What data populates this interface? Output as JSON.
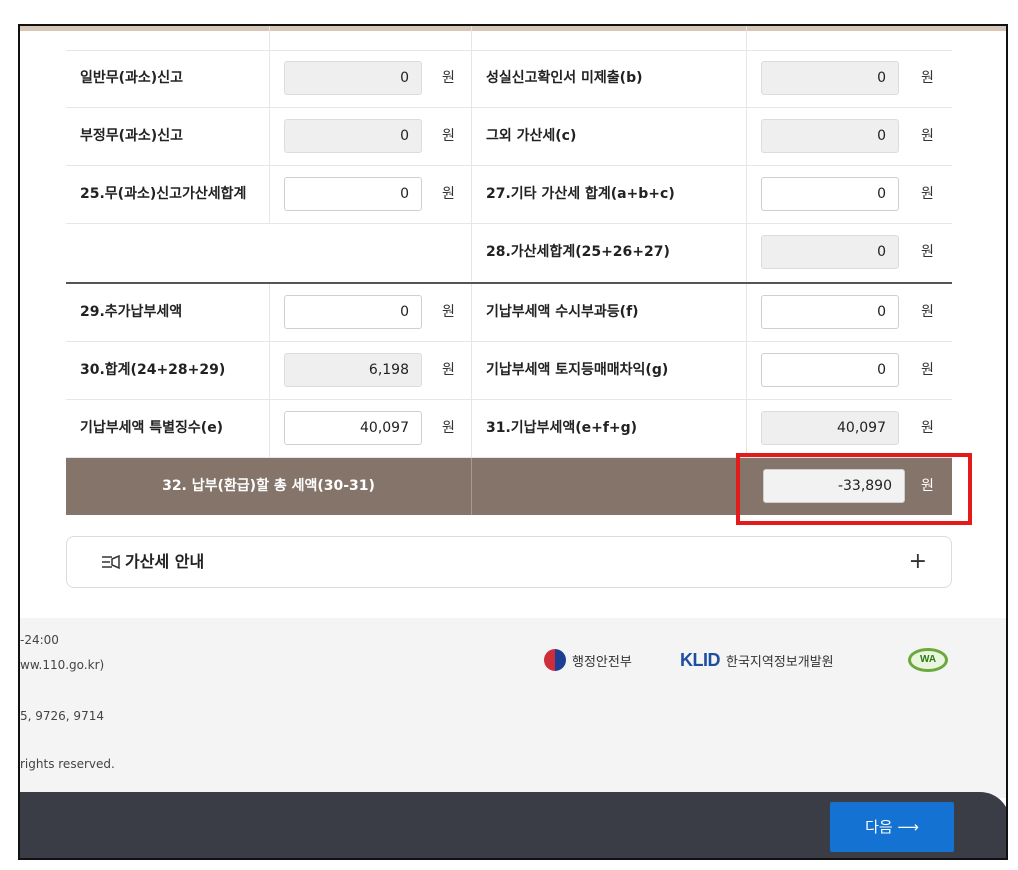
{
  "rows": [
    {
      "left_label": "일반무(과소)신고",
      "left_value": "0",
      "right_label": "성실신고확인서 미제출(b)",
      "right_value": "0"
    },
    {
      "left_label": "부정무(과소)신고",
      "left_value": "0",
      "right_label": "그외 가산세(c)",
      "right_value": "0"
    },
    {
      "left_label": "25.무(과소)신고가산세합계",
      "left_value": "0",
      "right_label": "27.기타 가산세 합계(a+b+c)",
      "right_value": "0"
    },
    {
      "left_label": "",
      "left_value": "",
      "right_label": "28.가산세합계(25+26+27)",
      "right_value": "0"
    },
    {
      "left_label": "29.추가납부세액",
      "left_value": "0",
      "right_label": "기납부세액 수시부과등(f)",
      "right_value": "0"
    },
    {
      "left_label": "30.합계(24+28+29)",
      "left_value": "6,198",
      "right_label": "기납부세액 토지등매매차익(g)",
      "right_value": "0"
    },
    {
      "left_label": "기납부세액 특별징수(e)",
      "left_value": "40,097",
      "right_label": "31.기납부세액(e+f+g)",
      "right_value": "40,097"
    }
  ],
  "unit": "원",
  "total": {
    "label": "32. 납부(환급)할 총 세액(30-31)",
    "value": "-33,890",
    "unit": "원"
  },
  "guide": {
    "title": "가산세 안내",
    "plus": "+"
  },
  "footer": {
    "line1": "-24:00",
    "line2": "ww.110.go.kr)",
    "line3": "5, 9726, 9714",
    "line4": "rights reserved.",
    "mois": "행정안전부",
    "klid_mark": "KLID",
    "klid_text": "한국지역정보개발원",
    "wa_text": "WA"
  },
  "next_button": "다음 ⟶",
  "colors": {
    "total_bg": "#85746a",
    "highlight": "#e31b1b",
    "next_btn": "#1472d3",
    "bottom_bar": "#3b3d46"
  }
}
